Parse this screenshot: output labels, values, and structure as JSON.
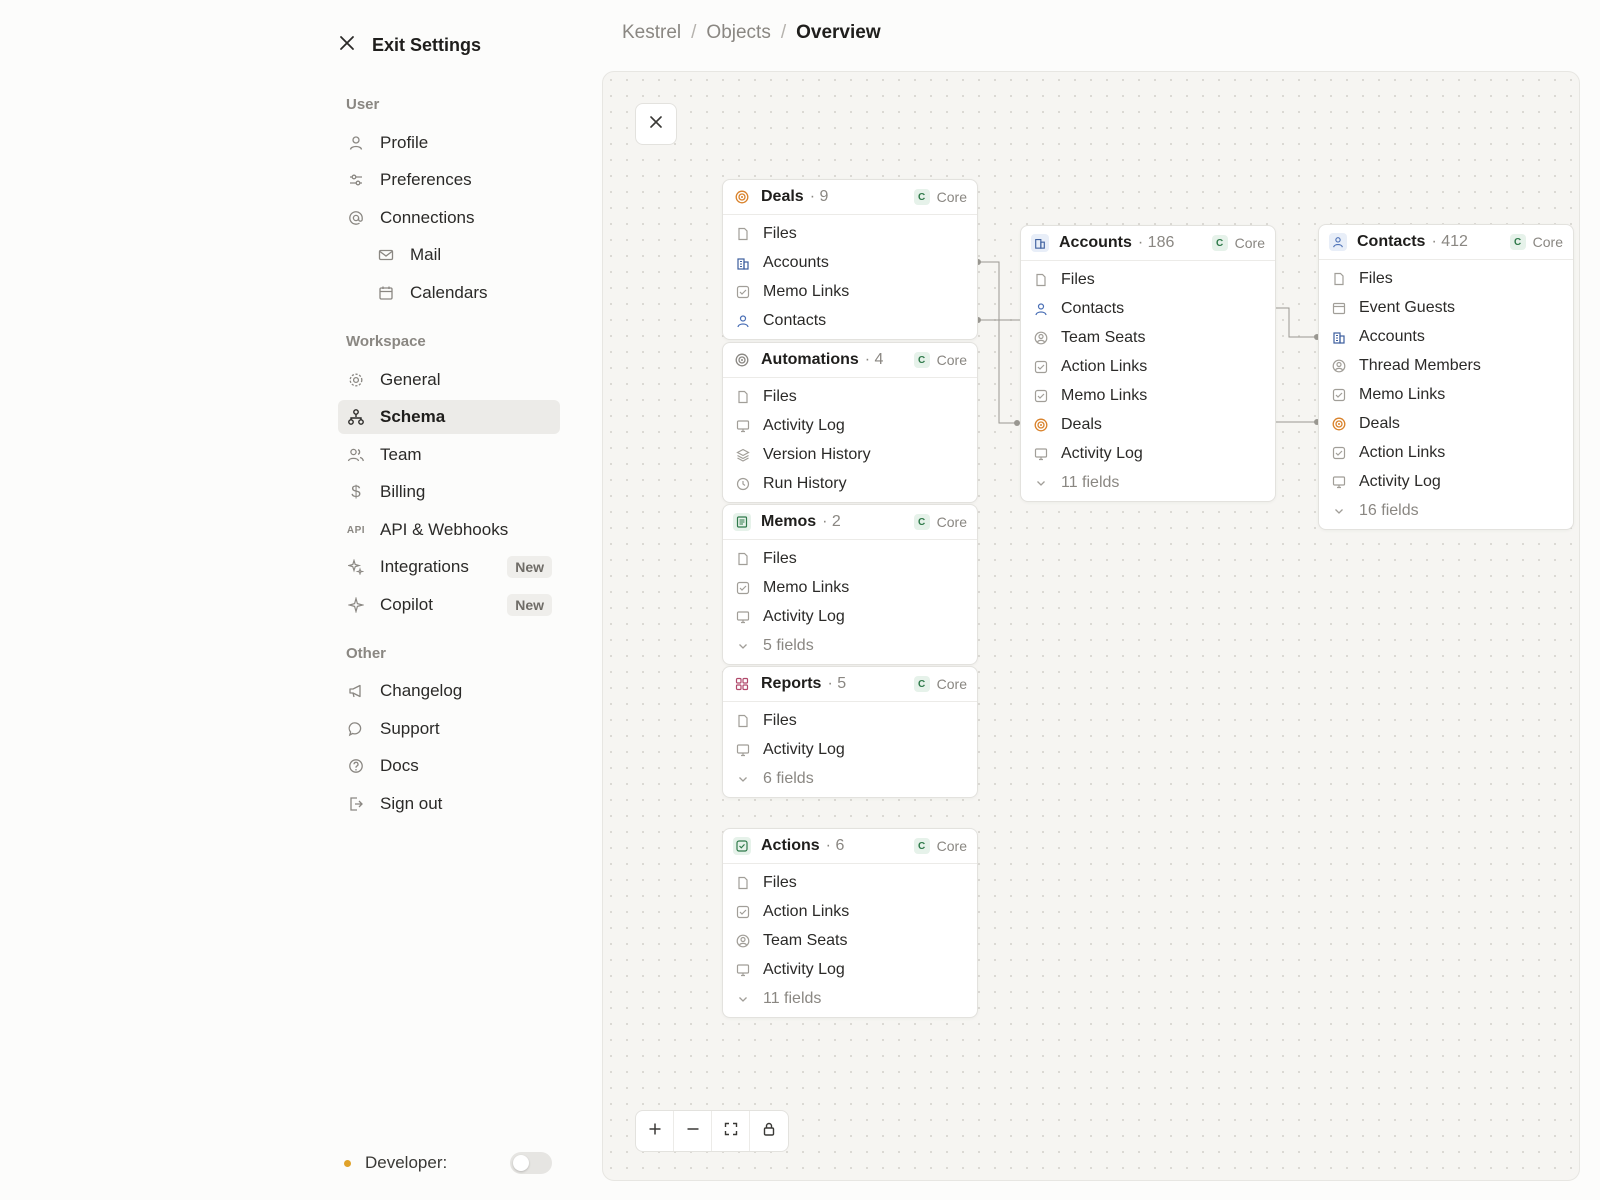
{
  "sidebar": {
    "exit_label": "Exit Settings",
    "sections": {
      "user": "User",
      "workspace": "Workspace",
      "other": "Other"
    },
    "items": {
      "profile": "Profile",
      "preferences": "Preferences",
      "connections": "Connections",
      "mail": "Mail",
      "calendars": "Calendars",
      "general": "General",
      "schema": "Schema",
      "team": "Team",
      "billing": "Billing",
      "api": "API & Webhooks",
      "api_icon_text": "API",
      "integrations": "Integrations",
      "copilot": "Copilot",
      "changelog": "Changelog",
      "support": "Support",
      "docs": "Docs",
      "signout": "Sign out"
    },
    "new_badge": "New",
    "developer_label": "Developer:",
    "developer_enabled": false
  },
  "breadcrumb": {
    "items": [
      "Kestrel",
      "Objects",
      "Overview"
    ],
    "separator": "/"
  },
  "schema": {
    "core_label": "Core",
    "core_letter": "C",
    "cards": {
      "deals": {
        "name": "Deals",
        "count": "· 9",
        "rows": [
          "Files",
          "Accounts",
          "Memo Links",
          "Contacts"
        ]
      },
      "automations": {
        "name": "Automations",
        "count": "· 4",
        "rows": [
          "Files",
          "Activity Log",
          "Version History",
          "Run History"
        ]
      },
      "memos": {
        "name": "Memos",
        "count": "· 2",
        "rows": [
          "Files",
          "Memo Links",
          "Activity Log"
        ],
        "more": "5 fields"
      },
      "reports": {
        "name": "Reports",
        "count": "· 5",
        "rows": [
          "Files",
          "Activity Log"
        ],
        "more": "6 fields"
      },
      "actions": {
        "name": "Actions",
        "count": "· 6",
        "rows": [
          "Files",
          "Action Links",
          "Team Seats",
          "Activity Log"
        ],
        "more": "11 fields"
      },
      "accounts": {
        "name": "Accounts",
        "count": "· 186",
        "rows": [
          "Files",
          "Contacts",
          "Team Seats",
          "Action Links",
          "Memo Links",
          "Deals",
          "Activity Log"
        ],
        "more": "11 fields"
      },
      "contacts": {
        "name": "Contacts",
        "count": "· 412",
        "rows": [
          "Files",
          "Event Guests",
          "Accounts",
          "Thread Members",
          "Memo Links",
          "Deals",
          "Action Links",
          "Activity Log"
        ],
        "more": "16 fields"
      }
    }
  },
  "colors": {
    "accent_active_bg": "#ecebe8",
    "deals_icon": "#d9822b",
    "accounts_icon": "#3c5e9e",
    "contacts_icon": "#4a6fb5",
    "memos_icon": "#2f7a4a",
    "reports_icon": "#b0486a",
    "core_badge": "#2f7a4a",
    "developer_dot": "#e0a22a"
  }
}
